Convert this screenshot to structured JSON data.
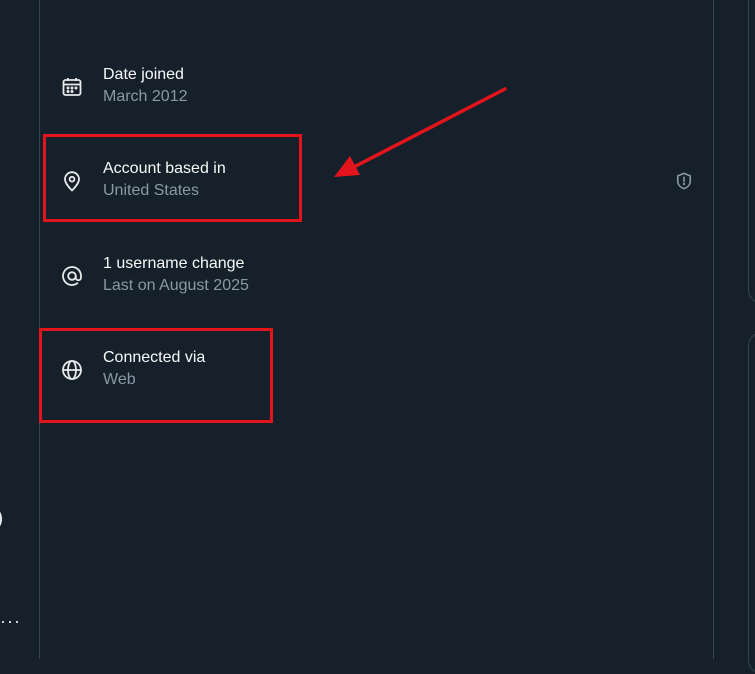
{
  "left_sidebar": {
    "more_glyph": "···"
  },
  "main": {
    "header_fragment": "_ _",
    "rows": [
      {
        "title": "Date joined",
        "subtitle": "March 2012",
        "icon": "calendar-icon"
      },
      {
        "title": "Account based in",
        "subtitle": "United States",
        "icon": "location-pin-icon"
      },
      {
        "title": "1 username change",
        "subtitle": "Last on August 2025",
        "icon": "at-sign-icon"
      },
      {
        "title": "Connected via",
        "subtitle": "Web",
        "icon": "globe-icon"
      }
    ],
    "info_icon": "shield-alert-icon"
  },
  "annotations": {
    "highlight_color": "#e3141b",
    "highlighted_rows": [
      "Account based in",
      "Connected via"
    ]
  },
  "colors": {
    "background": "#15202b",
    "text_primary": "#f7f9f9",
    "text_secondary": "#8b98a5",
    "border": "#38444d"
  }
}
